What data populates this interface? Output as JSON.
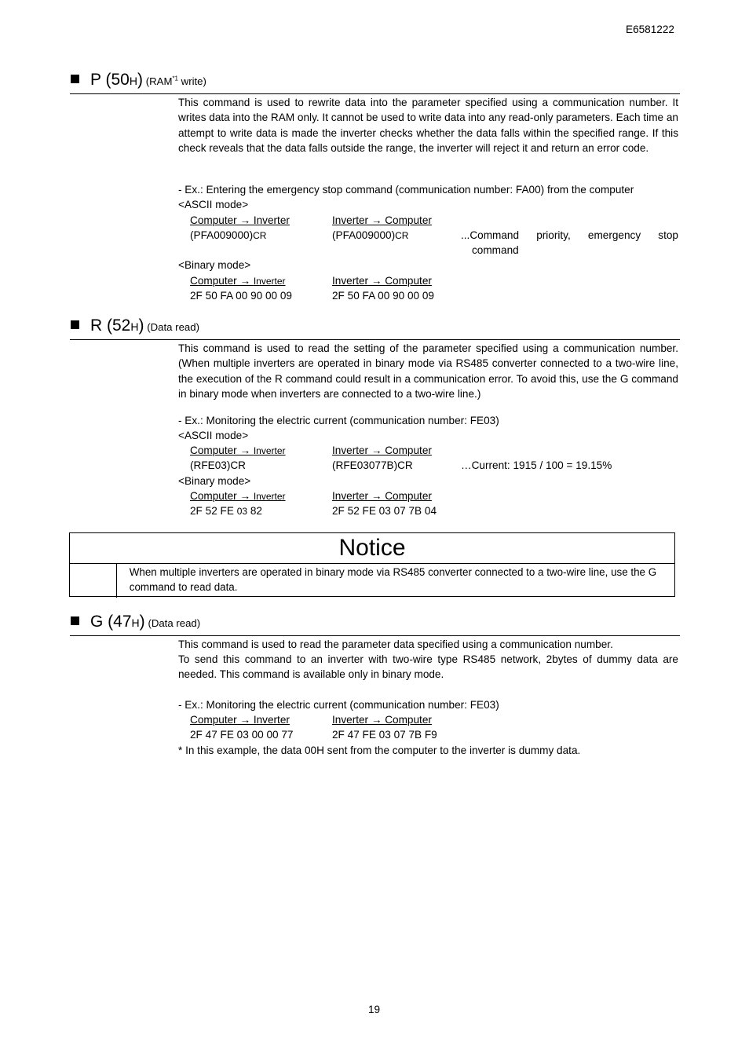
{
  "doc_id": "E6581222",
  "page_number": "19",
  "sections": {
    "p": {
      "letter": "P (50",
      "hex_suffix": "H",
      "close": ")",
      "subtitle_pre": "(RAM",
      "subtitle_sup": "*1",
      "subtitle_post": " write)",
      "description": "This command is used to rewrite data into the parameter specified using a communication number. It writes data into the RAM only. It cannot be used to write data into any read-only parameters. Each time an attempt to write data is made the inverter checks whether the data falls within the specified range. If this check reveals that the data falls outside the range, the inverter will reject it and return an error code.",
      "example": "- Ex.: Entering the emergency stop command (communication number: FA00) from the computer",
      "ascii_mode": "<ASCII mode>",
      "ascii_col1_header": "Computer → Inverter",
      "ascii_col2_header": "Inverter → Computer",
      "ascii_col1_value": "(PFA009000)",
      "ascii_col1_cr": "CR",
      "ascii_col2_value": "(PFA009000)",
      "ascii_col2_cr": "CR",
      "ascii_note_words": [
        "...Command",
        "priority,",
        "emergency",
        "stop"
      ],
      "ascii_note_line2": "command",
      "binary_mode": "<Binary mode>",
      "binary_col1_header_a": "Computer → ",
      "binary_col1_header_b": "Inverter",
      "binary_col2_header": "Inverter → Computer",
      "binary_col1_value": "2F 50 FA 00 90 00 09",
      "binary_col2_value": "2F 50 FA 00 90 00 09"
    },
    "r": {
      "letter": "R (52",
      "hex_suffix": "H",
      "close": ")",
      "subtitle": "(Data read)",
      "description": "This command is used to read the setting of the parameter specified using a communication number. (When multiple inverters are operated in binary mode via RS485 converter connected to a two-wire line, the execution of the R command could result in a communication error. To avoid this, use the G command in binary mode when inverters are connected to a two-wire line.)",
      "example": "- Ex.: Monitoring the electric current (communication number: FE03)",
      "ascii_mode": "<ASCII mode>",
      "ascii_col1_header_a": "Computer → ",
      "ascii_col1_header_b": "Inverter",
      "ascii_col2_header": "Inverter → Computer",
      "ascii_col1_value": "(RFE03)CR",
      "ascii_col2_value": "(RFE03077B)CR",
      "ascii_note": "…Current: 1915 / 100 = 19.15%",
      "binary_mode": "<Binary mode>",
      "binary_col1_header_a": "Computer → ",
      "binary_col1_header_b": "Inverter",
      "binary_col2_header": "Inverter → Computer",
      "binary_col1_value_a": "2F 52 FE ",
      "binary_col1_value_b": "03",
      "binary_col1_value_c": " 82",
      "binary_col2_value": "2F 52 FE 03 07 7B 04"
    },
    "notice": {
      "title": "Notice",
      "text": "When multiple inverters are operated in binary mode via RS485 converter connected to a two-wire line, use the G command to read data."
    },
    "g": {
      "letter": "G (47",
      "hex_suffix": "H",
      "close": ")",
      "subtitle": "(Data read)",
      "description_1": "This command is used to read the parameter data specified using a communication number.",
      "description_2": "To send this command to an inverter with two-wire type RS485 network, 2bytes of dummy data are needed. This command is available only in binary mode.",
      "example": "- Ex.: Monitoring the electric current (communication number: FE03)",
      "col1_header": "Computer → Inverter",
      "col2_header": "Inverter → Computer",
      "col1_value": "2F 47 FE 03 00 00 77",
      "col2_value": "2F 47 FE 03 07 7B F9",
      "footnote": "* In this example, the data 00H sent from the computer to the inverter is dummy data."
    }
  }
}
